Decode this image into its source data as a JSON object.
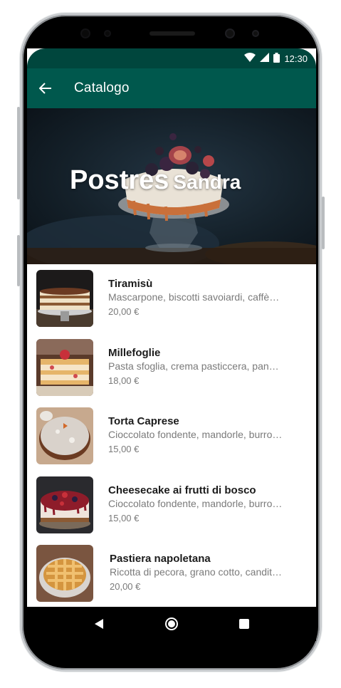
{
  "status_bar": {
    "time": "12:30",
    "icons": [
      "wifi-icon",
      "signal-icon",
      "battery-icon"
    ]
  },
  "app_bar": {
    "title": "Catalogo",
    "back_icon": "arrow-left-icon"
  },
  "hero": {
    "title_main": "Postres",
    "title_sub": "Sandra"
  },
  "colors": {
    "status_bar": "#00463d",
    "app_bar": "#00584d",
    "text_primary": "#1b1b1b",
    "text_secondary": "#7a7a7a"
  },
  "items": [
    {
      "name": "Tiramisù",
      "description": "Mascarpone, biscotti savoiardi, caffè…",
      "price": "20,00 €"
    },
    {
      "name": "Millefoglie",
      "description": "Pasta sfoglia, crema pasticcera, panna…",
      "price": "18,00 €"
    },
    {
      "name": "Torta Caprese",
      "description": "Cioccolato fondente, mandorle, burro…",
      "price": "15,00 €"
    },
    {
      "name": "Cheesecake ai frutti di bosco",
      "description": "Cioccolato fondente, mandorle, burro…",
      "price": "15,00 €"
    },
    {
      "name": "Pastiera napoletana",
      "description": "Ricotta di pecora, grano cotto, canditi…",
      "price": "20,00 €"
    }
  ],
  "nav_bar": {
    "buttons": [
      "back-triangle-icon",
      "home-circle-icon",
      "recents-square-icon"
    ]
  }
}
